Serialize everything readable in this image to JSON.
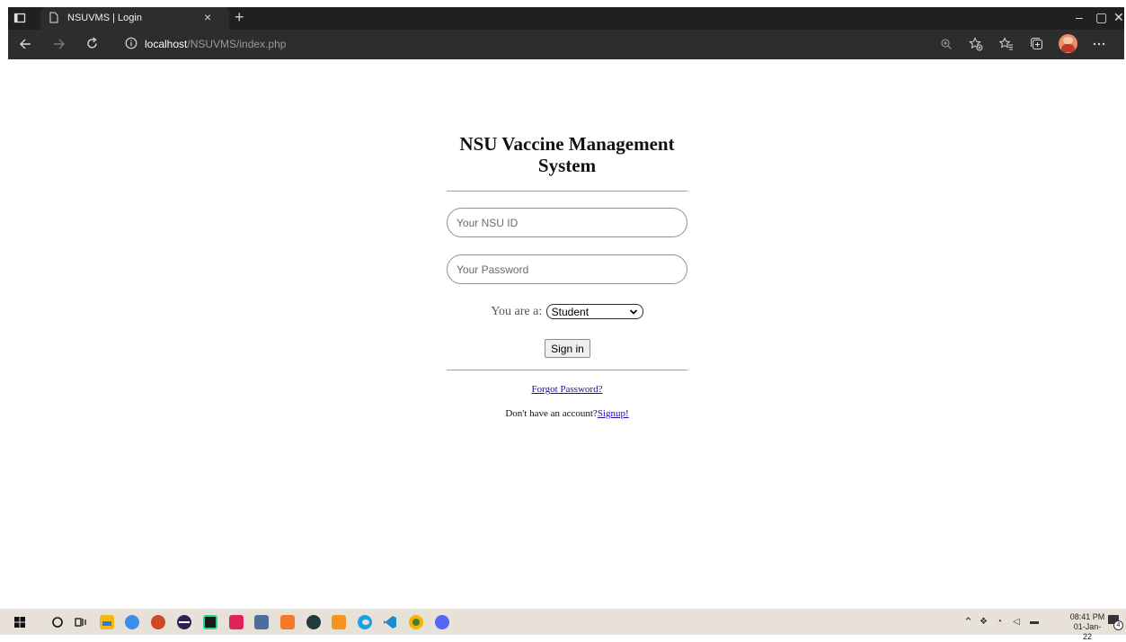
{
  "browser": {
    "tab_title": "NSUVMS | Login",
    "tab_close": "×",
    "new_tab": "+",
    "url_host": "localhost",
    "url_path": "/NSUVMS/index.php",
    "window_controls": [
      "–",
      "▢",
      "✕"
    ],
    "icons": [
      "tab-actions-icon",
      "page-icon",
      "back-icon",
      "forward-icon",
      "refresh-icon",
      "info-icon",
      "zoom-icon",
      "add-favorite-icon",
      "favorites-icon",
      "collections-icon",
      "profile-avatar",
      "more-icon"
    ]
  },
  "login": {
    "title": "NSU Vaccine Management System",
    "id_placeholder": "Your NSU ID",
    "password_placeholder": "Your Password",
    "role_label": "You are a:",
    "role_selected": "Student",
    "signin_label": "Sign in",
    "forgot_label": "Forgot Password?",
    "no_account_text": "Don't have an account?",
    "signup_label": "Signup!"
  },
  "taskbar": {
    "apps": [
      "windows-start-icon",
      "search-icon",
      "task-view-icon",
      "file-explorer-icon",
      "qbittorrent-icon",
      "powerpoint-icon",
      "eclipse-icon",
      "pycharm-icon",
      "intellij-icon",
      "sublime-icon",
      "xampp-icon",
      "app-icon",
      "git-icon",
      "edge-icon",
      "vscode-icon",
      "chrome-canary-icon",
      "discord-icon"
    ],
    "time": "08:41 PM",
    "date": "01-Jan-22",
    "notification_count": "4",
    "colors": {
      "chrome_dark": "#202020",
      "taskbar_bg": "#e8e1d8",
      "link_blue": "#1a0dab"
    }
  }
}
